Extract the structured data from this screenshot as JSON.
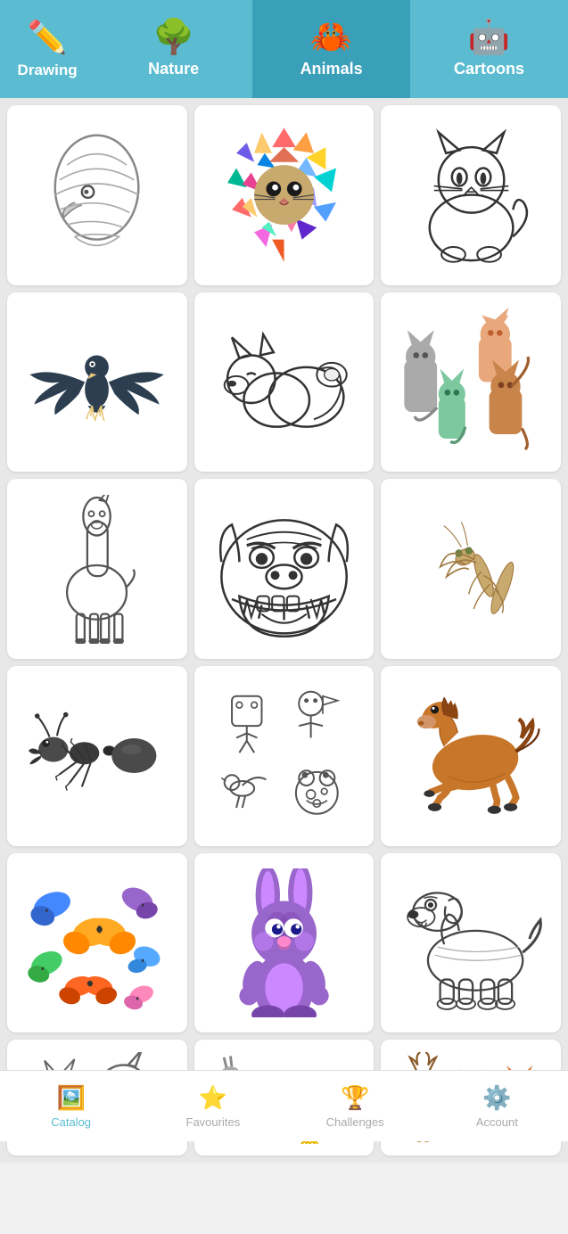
{
  "nav": {
    "tabs": [
      {
        "id": "drawing",
        "label": "Drawing",
        "icon": "✏️",
        "active": false,
        "partial": true
      },
      {
        "id": "nature",
        "label": "Nature",
        "icon": "🌳",
        "active": false
      },
      {
        "id": "animals",
        "label": "Animals",
        "icon": "🦀",
        "active": true
      },
      {
        "id": "cartoons",
        "label": "Cartoons",
        "icon": "🤖",
        "active": false
      }
    ]
  },
  "grid": {
    "items": [
      {
        "id": "eagle-sketch",
        "label": "Eagle sketch",
        "type": "eagle-sketch"
      },
      {
        "id": "colorful-lion",
        "label": "Colorful lion",
        "type": "colorful-lion"
      },
      {
        "id": "cat-sketch",
        "label": "Cat sketch",
        "type": "cat-sketch"
      },
      {
        "id": "eagle-wings",
        "label": "Eagle with wings",
        "type": "eagle-wings"
      },
      {
        "id": "fox-sketch",
        "label": "Fox sketch",
        "type": "fox-sketch"
      },
      {
        "id": "cats-group",
        "label": "Cats group",
        "type": "cats-group"
      },
      {
        "id": "llama-sketch",
        "label": "Llama sketch",
        "type": "llama-sketch"
      },
      {
        "id": "bulldog-sketch",
        "label": "Bulldog sketch",
        "type": "bulldog-sketch"
      },
      {
        "id": "mantis",
        "label": "Praying mantis",
        "type": "mantis"
      },
      {
        "id": "ant",
        "label": "Ant",
        "type": "ant"
      },
      {
        "id": "small-animals",
        "label": "Small animals sketches",
        "type": "small-animals"
      },
      {
        "id": "horse",
        "label": "Running horse",
        "type": "horse"
      },
      {
        "id": "butterflies",
        "label": "Butterflies collection",
        "type": "butterflies"
      },
      {
        "id": "rabbit",
        "label": "Purple rabbit cartoon",
        "type": "rabbit"
      },
      {
        "id": "dog-sketch",
        "label": "Dog sketch",
        "type": "dog-sketch"
      },
      {
        "id": "wolves",
        "label": "Wolves",
        "type": "wolves"
      },
      {
        "id": "farm-animals",
        "label": "Farm animals",
        "type": "farm-animals"
      },
      {
        "id": "forest-animals",
        "label": "Forest animals",
        "type": "forest-animals"
      }
    ]
  },
  "bottomNav": {
    "tabs": [
      {
        "id": "catalog",
        "label": "Catalog",
        "icon": "🖼️",
        "active": true
      },
      {
        "id": "favourites",
        "label": "Favourites",
        "icon": "⭐",
        "active": false
      },
      {
        "id": "challenges",
        "label": "Challenges",
        "icon": "🏆",
        "active": false
      },
      {
        "id": "account",
        "label": "Account",
        "icon": "⚙️",
        "active": false
      }
    ]
  }
}
